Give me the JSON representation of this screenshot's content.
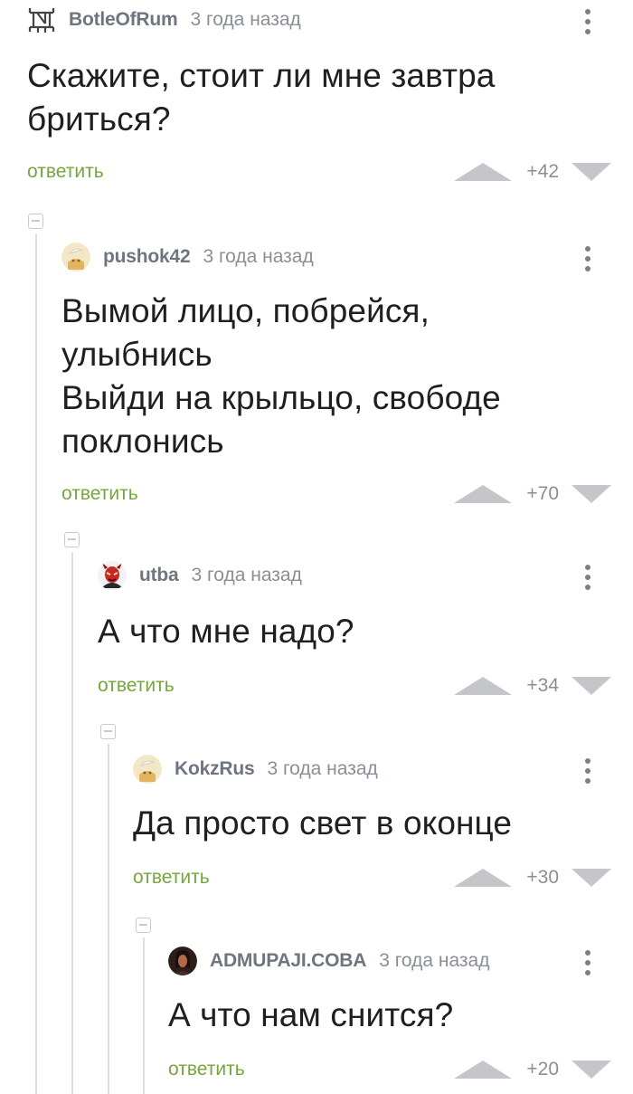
{
  "comments": [
    {
      "author": "BotleOfRum",
      "time": "3 года назад",
      "text_lines": [
        "Скажите, стоит ли мне завтра",
        "бриться?"
      ],
      "reply_label": "ответить",
      "score": "+42",
      "avatar_icon": "band-logo-icon"
    },
    {
      "author": "pushok42",
      "time": "3 года назад",
      "text_lines": [
        "Вымой лицо, побрейся,",
        "улыбнись",
        "Выйди на крыльцо, свободе",
        "поклонись"
      ],
      "reply_label": "ответить",
      "score": "+70",
      "avatar_icon": "default-avatar-icon"
    },
    {
      "author": "utba",
      "time": "3 года назад",
      "text_lines": [
        "А что мне надо?"
      ],
      "reply_label": "ответить",
      "score": "+34",
      "avatar_icon": "red-demon-avatar-icon"
    },
    {
      "author": "KokzRus",
      "time": "3 года назад",
      "text_lines": [
        "Да просто свет в оконце"
      ],
      "reply_label": "ответить",
      "score": "+30",
      "avatar_icon": "default-avatar-icon"
    },
    {
      "author": "ADMUPAJI.COBA",
      "time": "3 года назад",
      "text_lines": [
        "А что нам снится?"
      ],
      "reply_label": "ответить",
      "score": "+20",
      "avatar_icon": "dark-portrait-avatar-icon"
    }
  ],
  "colors": {
    "reply_green": "#76a63c",
    "meta_gray": "#8a8f96",
    "vote_arrow": "#c4c6ca",
    "thread_line": "#dcdee1"
  }
}
